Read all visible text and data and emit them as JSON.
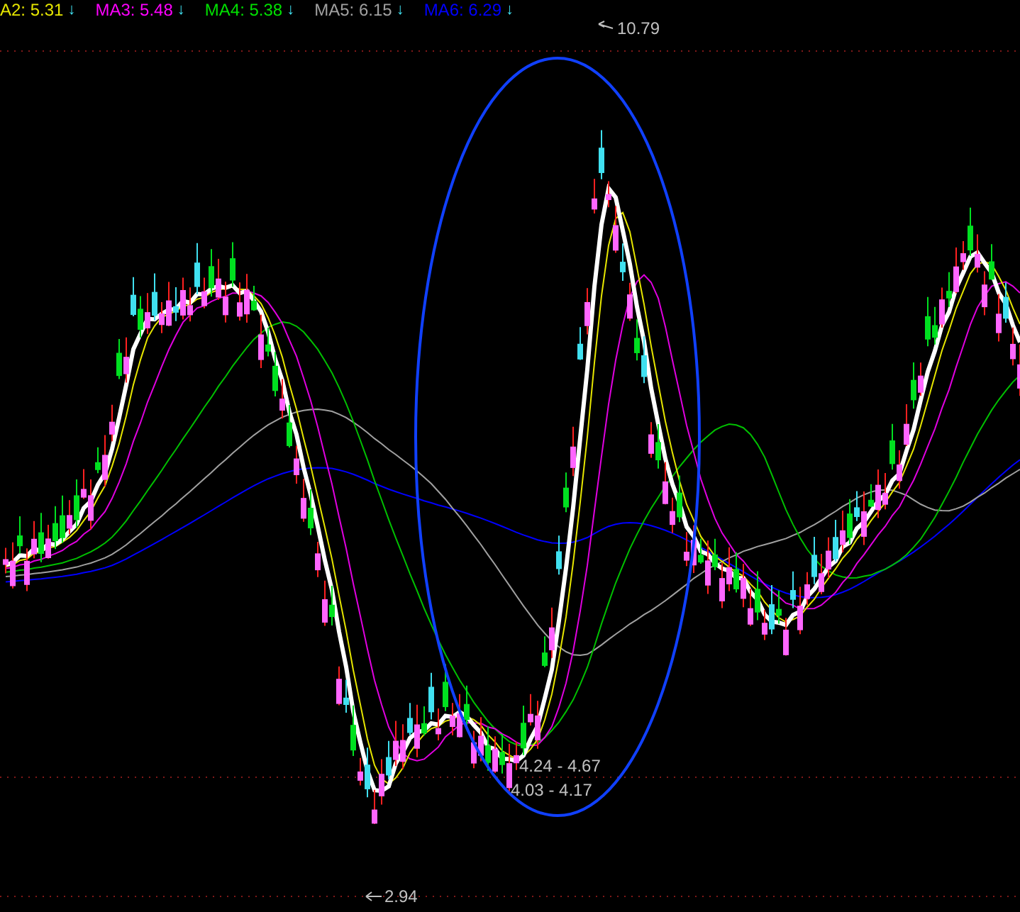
{
  "legend": [
    {
      "label": "A2: 5.31",
      "arrow": "↓",
      "color": "#e6e600"
    },
    {
      "label": "MA3: 5.48",
      "arrow": "↓",
      "color": "#ff00ff"
    },
    {
      "label": "MA4: 5.38",
      "arrow": "↓",
      "color": "#00e000"
    },
    {
      "label": "MA5: 6.15",
      "arrow": "↓",
      "color": "#a0a0a0"
    },
    {
      "label": "MA6: 6.29",
      "arrow": "↓",
      "color": "#0000ff"
    }
  ],
  "chart": {
    "high_label": "10.79",
    "low_label": "2.94",
    "ranges": [
      "4.24 - 4.67",
      "4.03 - 4.17"
    ]
  }
}
